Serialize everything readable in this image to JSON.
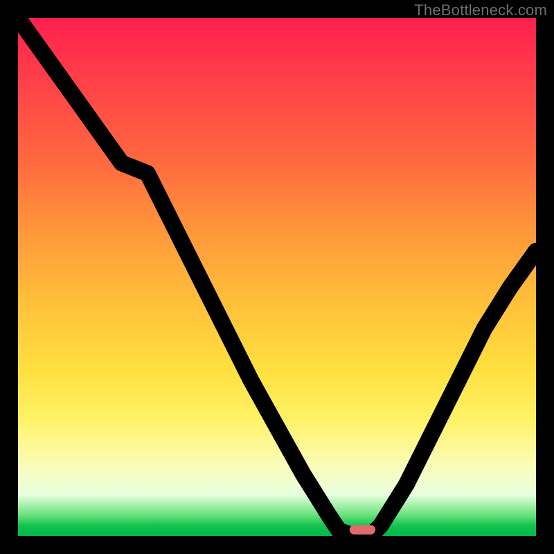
{
  "watermark": "TheBottleneck.com",
  "gradient_colors": {
    "top": "#ff1f4e",
    "mid_upper": "#ff9a3a",
    "mid": "#ffe03f",
    "mid_lower": "#fbfcb6",
    "bottom": "#00b84a"
  },
  "chart_data": {
    "type": "line",
    "title": "",
    "xlabel": "",
    "ylabel": "",
    "xlim": [
      0,
      100
    ],
    "ylim": [
      0,
      100
    ],
    "x": [
      0,
      5,
      10,
      15,
      20,
      25,
      30,
      35,
      40,
      45,
      50,
      55,
      60,
      62,
      65,
      68,
      70,
      75,
      80,
      85,
      90,
      95,
      100
    ],
    "values": [
      100,
      93,
      86,
      79,
      72,
      70,
      60,
      50,
      40,
      30,
      21,
      12,
      4,
      1,
      0,
      0,
      2,
      10,
      20,
      30,
      40,
      48,
      55
    ],
    "marker": {
      "x": 66.5,
      "y": 0.3,
      "color": "#e26a6a"
    }
  }
}
